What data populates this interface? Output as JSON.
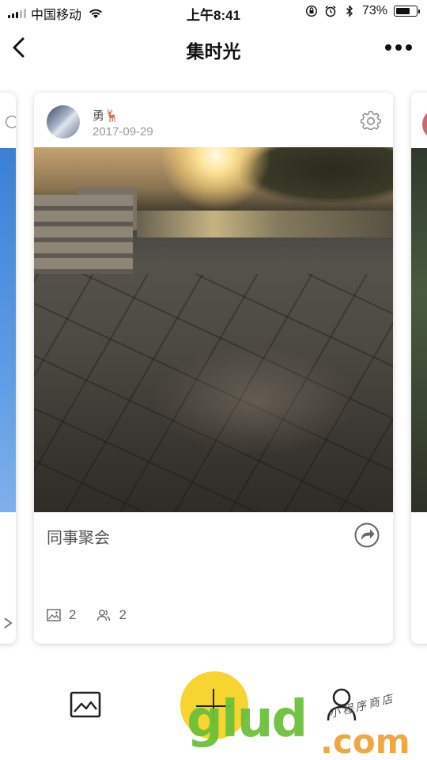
{
  "status_bar": {
    "carrier": "中国移动",
    "time": "上午8:41",
    "battery_percent": "73%",
    "battery_level": 0.73
  },
  "nav": {
    "title": "集时光",
    "back_icon": "chevron-left-icon",
    "more_icon": "more-dots-icon"
  },
  "album_card": {
    "user_name": "勇🦌",
    "date": "2017-09-29",
    "title": "同事聚会",
    "photo_count": "2",
    "member_count": "2",
    "photo_description": "sunset over a riverside stone plaza"
  },
  "toolbar": {
    "gallery_icon": "image-gallery-icon",
    "add_icon": "plus-icon",
    "profile_icon": "user-icon",
    "add_color": "#f7d531"
  },
  "watermark": {
    "main": "glud",
    "suffix": ".com",
    "sub": "小程序商店"
  }
}
